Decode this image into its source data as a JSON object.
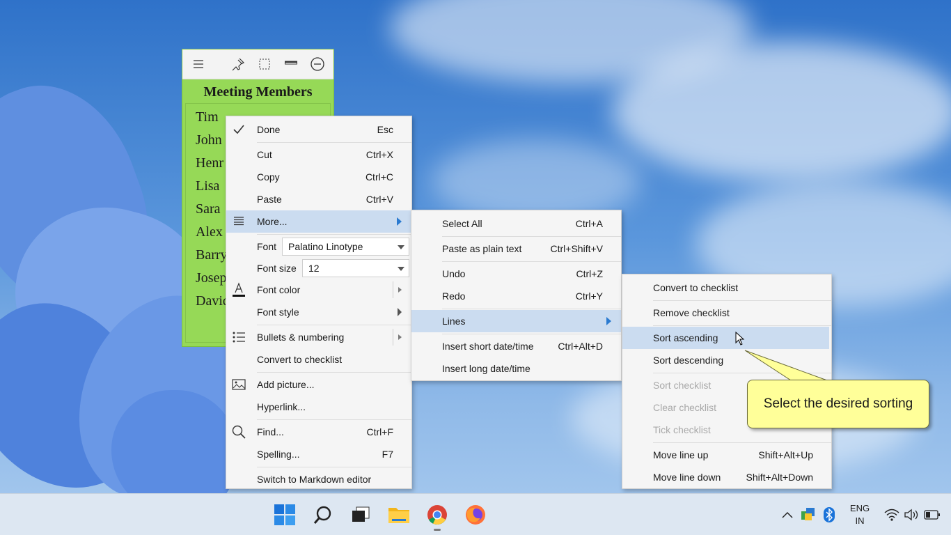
{
  "note": {
    "title": "Meeting Members",
    "lines": [
      "Tim",
      "John",
      "Henr",
      "Lisa",
      "Sara",
      "Alex",
      "Barry",
      "Josep",
      "David"
    ],
    "color": "#96d957"
  },
  "context_menu": {
    "done": {
      "label": "Done",
      "shortcut": "Esc"
    },
    "cut": {
      "label": "Cut",
      "shortcut": "Ctrl+X"
    },
    "copy": {
      "label": "Copy",
      "shortcut": "Ctrl+C"
    },
    "paste": {
      "label": "Paste",
      "shortcut": "Ctrl+V"
    },
    "more": {
      "label": "More..."
    },
    "font": {
      "label": "Font",
      "value": "Palatino Linotype"
    },
    "font_size": {
      "label": "Font size",
      "value": "12"
    },
    "font_color": {
      "label": "Font color"
    },
    "font_style": {
      "label": "Font style"
    },
    "bullets": {
      "label": "Bullets & numbering"
    },
    "convert_checklist": {
      "label": "Convert to checklist"
    },
    "add_picture": {
      "label": "Add picture..."
    },
    "hyperlink": {
      "label": "Hyperlink..."
    },
    "find": {
      "label": "Find...",
      "shortcut": "Ctrl+F"
    },
    "spelling": {
      "label": "Spelling...",
      "shortcut": "F7"
    },
    "markdown": {
      "label": "Switch to Markdown editor"
    }
  },
  "more_menu": {
    "select_all": {
      "label": "Select All",
      "shortcut": "Ctrl+A"
    },
    "paste_plain": {
      "label": "Paste as plain text",
      "shortcut": "Ctrl+Shift+V"
    },
    "undo": {
      "label": "Undo",
      "shortcut": "Ctrl+Z"
    },
    "redo": {
      "label": "Redo",
      "shortcut": "Ctrl+Y"
    },
    "lines": {
      "label": "Lines"
    },
    "short_date": {
      "label": "Insert short date/time",
      "shortcut": "Ctrl+Alt+D"
    },
    "long_date": {
      "label": "Insert long date/time"
    }
  },
  "lines_menu": {
    "convert": {
      "label": "Convert to checklist"
    },
    "remove": {
      "label": "Remove checklist"
    },
    "sort_asc": {
      "label": "Sort ascending"
    },
    "sort_desc": {
      "label": "Sort descending"
    },
    "sort_checklist": {
      "label": "Sort checklist"
    },
    "clear_checklist": {
      "label": "Clear checklist"
    },
    "tick_checklist": {
      "label": "Tick checklist"
    },
    "move_up": {
      "label": "Move line up",
      "shortcut": "Shift+Alt+Up"
    },
    "move_down": {
      "label": "Move line down",
      "shortcut": "Shift+Alt+Down"
    }
  },
  "callout": {
    "text": "Select the desired sorting"
  },
  "taskbar": {
    "lang_top": "ENG",
    "lang_bottom": "IN"
  },
  "colors": {
    "highlight": "#cbdcf0",
    "accent": "#2a7ad0",
    "callout_bg": "#ffff99"
  }
}
